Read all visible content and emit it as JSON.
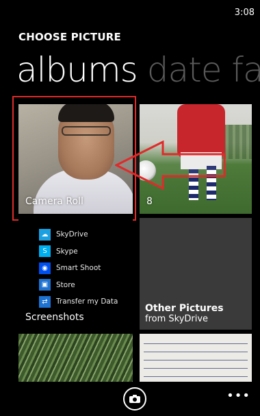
{
  "status": {
    "time": "3:08"
  },
  "header": {
    "title": "CHOOSE PICTURE"
  },
  "pivot": {
    "active": "albums",
    "next": "date fa"
  },
  "tiles": {
    "camera_roll": {
      "label": "Camera Roll"
    },
    "count_tile": {
      "label": "8"
    },
    "screenshots": {
      "label": "Screenshots",
      "items": [
        {
          "label": "SkyDrive",
          "icon": "cloud-icon",
          "color": "#1ba1e2"
        },
        {
          "label": "Skype",
          "icon": "skype-icon",
          "color": "#00aff0"
        },
        {
          "label": "Smart Shoot",
          "icon": "smart-shoot-icon",
          "color": "#0050ef"
        },
        {
          "label": "Store",
          "icon": "store-icon",
          "color": "#1e73d2"
        },
        {
          "label": "Transfer my Data",
          "icon": "transfer-icon",
          "color": "#1e73d2"
        }
      ]
    },
    "other_pictures": {
      "title": "Other Pictures",
      "subtitle": "from SkyDrive"
    }
  },
  "appbar": {
    "camera_icon": "camera-icon",
    "more": "•••"
  },
  "colors": {
    "highlight": "#e02a2a",
    "tile_gray": "#3a3a3a"
  }
}
